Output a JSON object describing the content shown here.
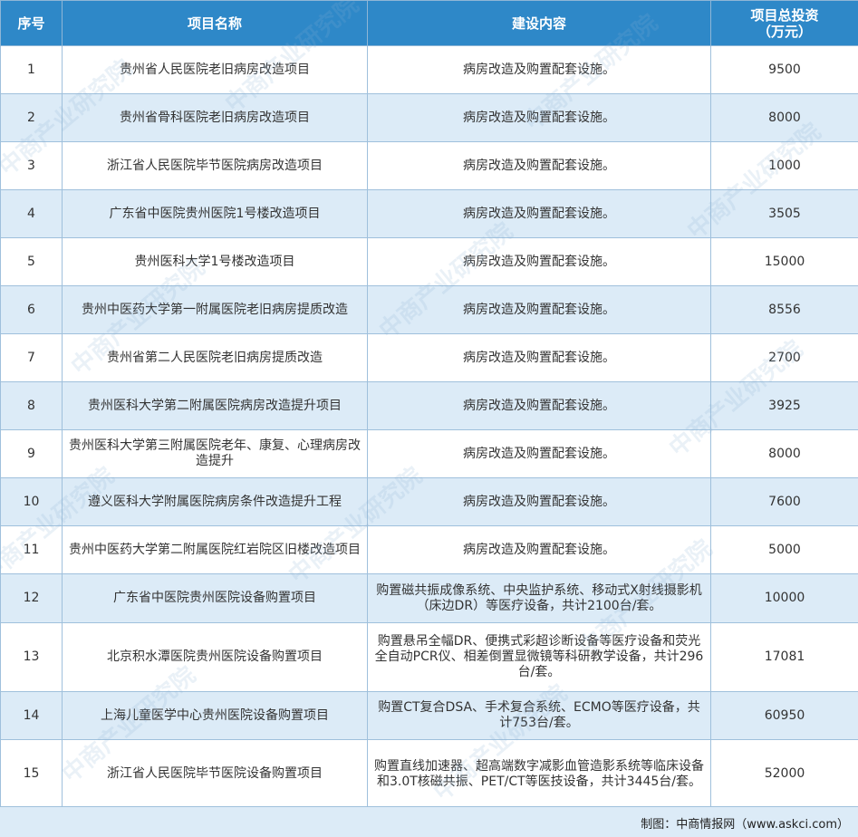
{
  "table": {
    "headers": {
      "index": "序号",
      "name": "项目名称",
      "content": "建设内容",
      "investment_line1": "项目总投资",
      "investment_line2": "（万元）"
    },
    "rows": [
      {
        "index": "1",
        "name": "贵州省人民医院老旧病房改造项目",
        "content": "病房改造及购置配套设施。",
        "investment": "9500"
      },
      {
        "index": "2",
        "name": "贵州省骨科医院老旧病房改造项目",
        "content": "病房改造及购置配套设施。",
        "investment": "8000"
      },
      {
        "index": "3",
        "name": "浙江省人民医院毕节医院病房改造项目",
        "content": "病房改造及购置配套设施。",
        "investment": "1000"
      },
      {
        "index": "4",
        "name": "广东省中医院贵州医院1号楼改造项目",
        "content": "病房改造及购置配套设施。",
        "investment": "3505"
      },
      {
        "index": "5",
        "name": "贵州医科大学1号楼改造项目",
        "content": "病房改造及购置配套设施。",
        "investment": "15000"
      },
      {
        "index": "6",
        "name": "贵州中医药大学第一附属医院老旧病房提质改造",
        "content": "病房改造及购置配套设施。",
        "investment": "8556"
      },
      {
        "index": "7",
        "name": "贵州省第二人民医院老旧病房提质改造",
        "content": "病房改造及购置配套设施。",
        "investment": "2700"
      },
      {
        "index": "8",
        "name": "贵州医科大学第二附属医院病房改造提升项目",
        "content": "病房改造及购置配套设施。",
        "investment": "3925"
      },
      {
        "index": "9",
        "name": "贵州医科大学第三附属医院老年、康复、心理病房改造提升",
        "content": "病房改造及购置配套设施。",
        "investment": "8000"
      },
      {
        "index": "10",
        "name": "遵义医科大学附属医院病房条件改造提升工程",
        "content": "病房改造及购置配套设施。",
        "investment": "7600"
      },
      {
        "index": "11",
        "name": "贵州中医药大学第二附属医院红岩院区旧楼改造项目",
        "content": "病房改造及购置配套设施。",
        "investment": "5000"
      },
      {
        "index": "12",
        "name": "广东省中医院贵州医院设备购置项目",
        "content": "购置磁共振成像系统、中央监护系统、移动式X射线摄影机（床边DR）等医疗设备，共计2100台/套。",
        "investment": "10000"
      },
      {
        "index": "13",
        "name": "北京积水潭医院贵州医院设备购置项目",
        "content": "购置悬吊全幅DR、便携式彩超诊断设备等医疗设备和荧光全自动PCR仪、相差倒置显微镜等科研教学设备，共计296台/套。",
        "investment": "17081"
      },
      {
        "index": "14",
        "name": "上海儿童医学中心贵州医院设备购置项目",
        "content": "购置CT复合DSA、手术复合系统、ECMO等医疗设备，共计753台/套。",
        "investment": "60950"
      },
      {
        "index": "15",
        "name": "浙江省人民医院毕节医院设备购置项目",
        "content": "购置直线加速器、超高端数字减影血管造影系统等临床设备和3.0T核磁共振、PET/CT等医技设备，共计3445台/套。",
        "investment": "52000"
      }
    ]
  },
  "footer": {
    "source": "制图：中商情报网（www.askci.com）"
  },
  "watermark": {
    "text": "中商产业研究院"
  },
  "colors": {
    "header_bg": "#2e88c8",
    "row_alt_bg": "#dcebf7",
    "border": "#9fc0dc"
  }
}
